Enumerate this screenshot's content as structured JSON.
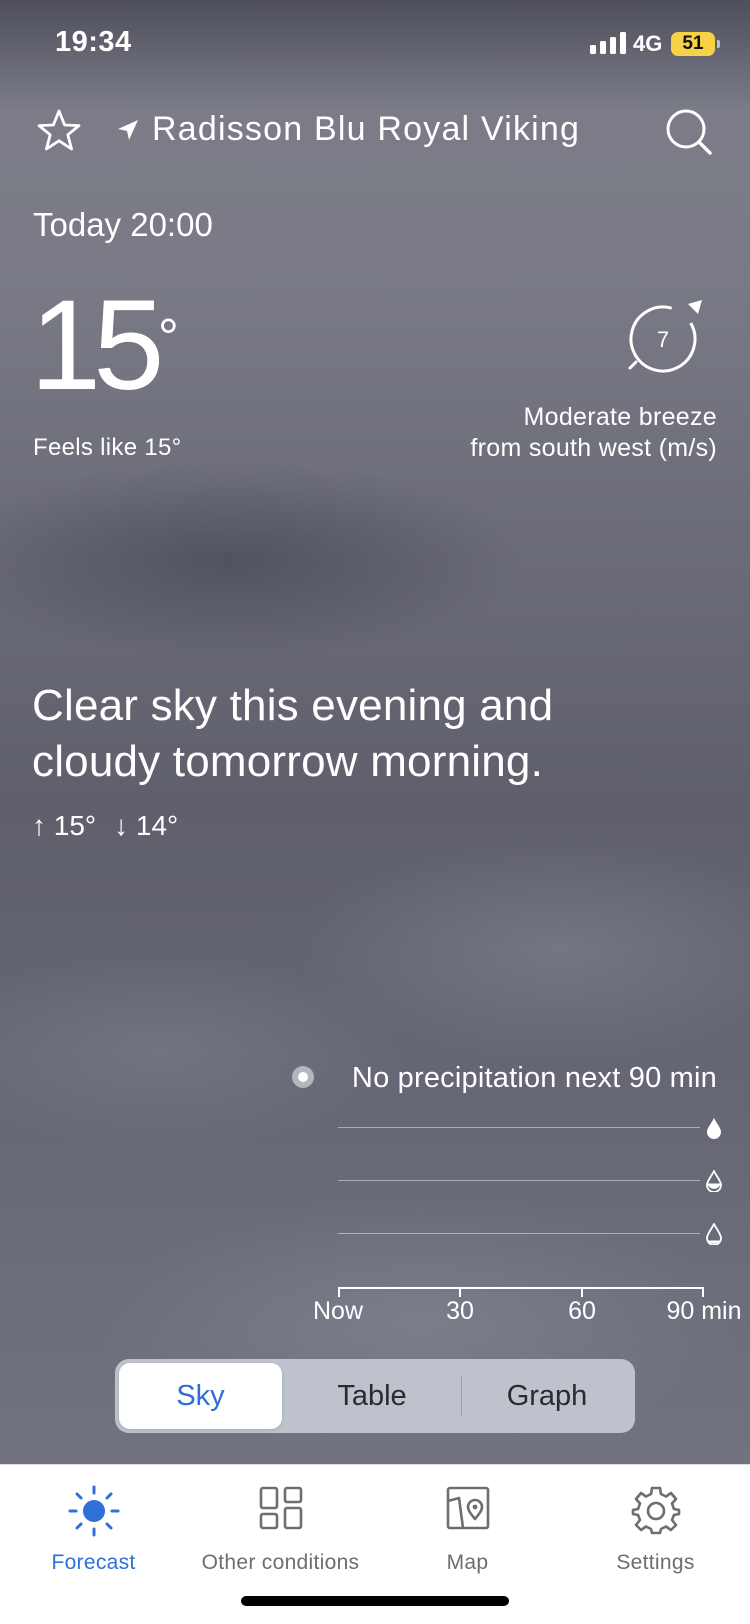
{
  "status_bar": {
    "time": "19:34",
    "network": "4G",
    "battery": "51"
  },
  "header": {
    "location": "Radisson Blu Royal Viking"
  },
  "now": {
    "time_label": "Today 20:00",
    "temperature": "15",
    "degree_symbol": "°",
    "feels_like": "Feels like 15°",
    "wind_speed": "7",
    "wind_line1": "Moderate breeze",
    "wind_line2": "from south west (m/s)"
  },
  "summary": {
    "text": "Clear sky this evening and cloudy tomorrow morning.",
    "high": "↑ 15°",
    "low": "↓ 14°"
  },
  "precipitation": {
    "message": "No precipitation next 90 min",
    "x_labels": [
      "Now",
      "30",
      "60",
      "90 min"
    ],
    "intensity_icons": [
      "heavy-drop-icon",
      "moderate-drop-icon",
      "light-drop-icon"
    ]
  },
  "view_tabs": {
    "items": [
      "Sky",
      "Table",
      "Graph"
    ],
    "selected": "Sky"
  },
  "tabbar": {
    "items": [
      {
        "label": "Forecast",
        "icon": "sun-icon",
        "active": true
      },
      {
        "label": "Other conditions",
        "icon": "grid-icon",
        "active": false
      },
      {
        "label": "Map",
        "icon": "map-icon",
        "active": false
      },
      {
        "label": "Settings",
        "icon": "gear-icon",
        "active": false
      }
    ]
  },
  "colors": {
    "accent": "#2f6fd6",
    "battery": "#f7d247"
  }
}
